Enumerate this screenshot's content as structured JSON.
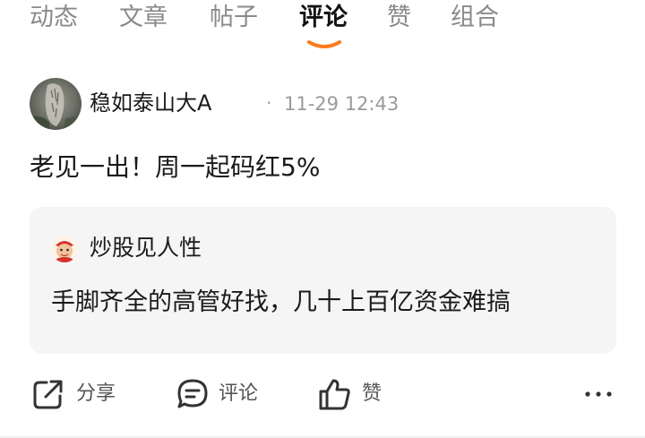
{
  "tabs": [
    {
      "label": "动态",
      "active": false
    },
    {
      "label": "文章",
      "active": false
    },
    {
      "label": "帖子",
      "active": false
    },
    {
      "label": "评论",
      "active": true
    },
    {
      "label": "赞",
      "active": false
    },
    {
      "label": "组合",
      "active": false
    }
  ],
  "post": {
    "author": "稳如泰山大A",
    "separator": "·",
    "time": "11-29 12:43",
    "content": "老见一出！周一起码红5%"
  },
  "quote": {
    "author": "炒股见人性",
    "text": "手脚齐全的高管好找，几十上百亿资金难搞"
  },
  "actions": {
    "share": {
      "label": "分享",
      "icon": "share-icon"
    },
    "comment": {
      "label": "评论",
      "icon": "comment-icon"
    },
    "like": {
      "label": "赞",
      "icon": "thumbs-up-icon"
    },
    "more": {
      "icon": "more-icon"
    }
  },
  "colors": {
    "accent": "#ff7a1a",
    "tab_inactive": "#8a8a8a",
    "tab_active": "#111111",
    "card_bg": "#f5f5f6"
  }
}
